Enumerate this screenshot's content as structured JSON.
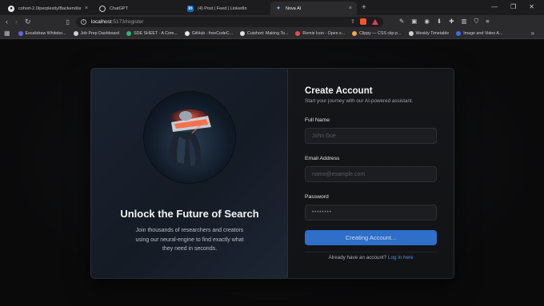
{
  "browser": {
    "tabs": [
      {
        "title": "cohort-2.0/perplexity/Backend/src/c...",
        "icon": "github-icon",
        "active": false
      },
      {
        "title": "ChatGPT",
        "icon": "chatgpt-icon",
        "active": false
      },
      {
        "title": "(4) Post | Feed | LinkedIn",
        "icon": "linkedin-icon",
        "active": false
      },
      {
        "title": "Nova AI",
        "icon": "nova-icon",
        "active": true
      }
    ],
    "new_tab": "+",
    "address": {
      "host": "localhost",
      "path": ":5173/register"
    },
    "bookmarks": [
      {
        "label": "Excalidraw Whitebo...",
        "color": "#6965db"
      },
      {
        "label": "Job Prep Dashboard",
        "color": "#d0d0d0"
      },
      {
        "label": "SDE SHEET - A Com...",
        "color": "#2bb673"
      },
      {
        "label": "GitHub - freeCodeC...",
        "color": "#e6e6e6"
      },
      {
        "label": "Cutshort: Making To...",
        "color": "#e0e0e0"
      },
      {
        "label": "Remix Icon - Open s...",
        "color": "#e64a4a"
      },
      {
        "label": "Clippy — CSS clip-p...",
        "color": "#f0a94a"
      },
      {
        "label": "Weekly Timetable",
        "color": "#cfcfcf"
      },
      {
        "label": "Image and Video A...",
        "color": "#3b6fe0"
      }
    ],
    "bookmarks_more": "»"
  },
  "hero": {
    "title": "Unlock the Future of Search",
    "text": "Join thousands of researchers and creators using our neural-engine to find exactly what they need in seconds."
  },
  "form": {
    "title": "Create Account",
    "subtitle": "Start your journey with our AI-powered assistant.",
    "fields": {
      "full_name": {
        "label": "Full Name",
        "placeholder": "John Doe"
      },
      "email": {
        "label": "Email Address",
        "placeholder": "name@example.com"
      },
      "password": {
        "label": "Password",
        "value": "••••••••"
      }
    },
    "submit_label": "Creating Account...",
    "footer_text": "Already have an account?",
    "login_link": "Log in here"
  },
  "colors": {
    "accent": "#2f6ec9",
    "link": "#4f8ff0",
    "background": "#0b0b0c"
  }
}
